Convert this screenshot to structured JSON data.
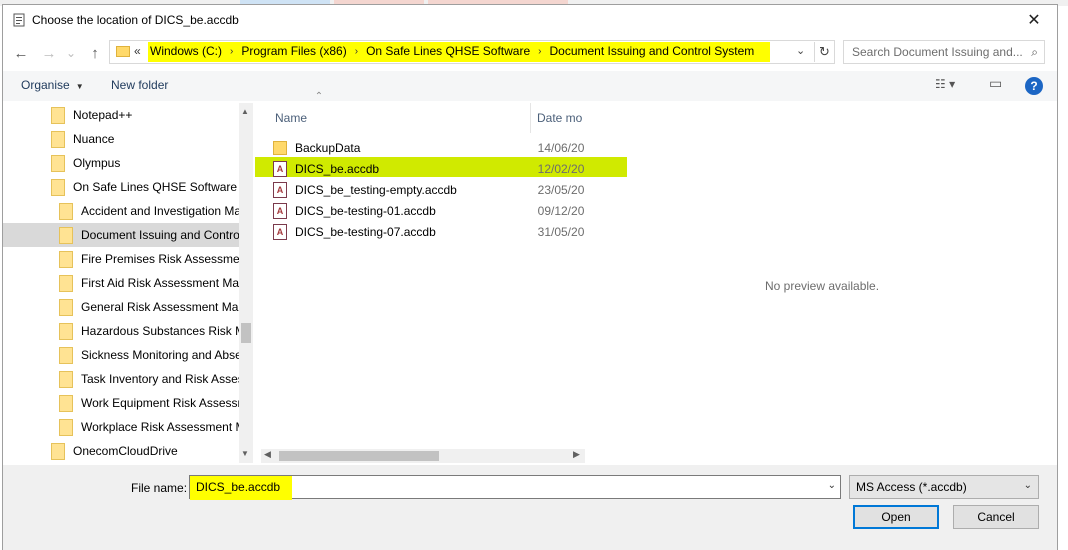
{
  "colors": {
    "highlight": "#ffff00",
    "selection_highlight": "#d0ea00",
    "help_blue": "#1c66c4",
    "focus_blue": "#0078d7"
  },
  "window": {
    "title": "Choose the location of DICS_be.accdb",
    "title_icon": "access-db-icon",
    "close_glyph": "✕"
  },
  "nav": {
    "back_glyph": "←",
    "forward_glyph": "→",
    "history_glyph": "⌄",
    "up_glyph": "↑",
    "overflow_glyph": "«",
    "breadcrumbs": [
      "Windows (C:)",
      "Program Files (x86)",
      "On Safe Lines QHSE Software",
      "Document Issuing and Control System"
    ],
    "crumb_separator": "›",
    "dropdown_glyph": "⌄",
    "refresh_glyph": "↻"
  },
  "search": {
    "placeholder": "Search Document Issuing and...",
    "icon_glyph": "⌕"
  },
  "toolbar": {
    "organise_label": "Organise",
    "organise_caret": "▼",
    "new_folder_label": "New folder",
    "view_glyph": "☷",
    "view_caret": "▾",
    "pane_glyph": "▭",
    "help_glyph": "?"
  },
  "tree": {
    "items": [
      {
        "label": "Notepad++",
        "level": 0
      },
      {
        "label": "Nuance",
        "level": 0
      },
      {
        "label": "Olympus",
        "level": 0
      },
      {
        "label": "On Safe Lines QHSE Software",
        "level": 0
      },
      {
        "label": "Accident and Investigation Ma",
        "level": 1
      },
      {
        "label": "Document Issuing and Contro",
        "level": 1,
        "selected": true
      },
      {
        "label": "Fire Premises Risk Assessment",
        "level": 1
      },
      {
        "label": "First Aid Risk Assessment Mar",
        "level": 1
      },
      {
        "label": "General Risk Assessment Mana",
        "level": 1
      },
      {
        "label": "Hazardous Substances Risk M",
        "level": 1
      },
      {
        "label": "Sickness Monitoring and Abse",
        "level": 1
      },
      {
        "label": "Task Inventory and Risk Asses",
        "level": 1
      },
      {
        "label": "Work Equipment Risk Assessm",
        "level": 1
      },
      {
        "label": "Workplace Risk Assessment M",
        "level": 1
      },
      {
        "label": "OnecomCloudDrive",
        "level": 0
      }
    ],
    "scroll_up": "▲",
    "scroll_down": "▼"
  },
  "files": {
    "columns": {
      "name": "Name",
      "date": "Date mo",
      "sort_glyph": "⌃"
    },
    "rows": [
      {
        "name": "BackupData",
        "date": "14/06/20",
        "icon": "folder-icon"
      },
      {
        "name": "DICS_be.accdb",
        "date": "12/02/20",
        "icon": "access-file-icon",
        "selected": true
      },
      {
        "name": "DICS_be_testing-empty.accdb",
        "date": "23/05/20",
        "icon": "access-file-icon"
      },
      {
        "name": "DICS_be-testing-01.accdb",
        "date": "09/12/20",
        "icon": "access-file-icon"
      },
      {
        "name": "DICS_be-testing-07.accdb",
        "date": "31/05/20",
        "icon": "access-file-icon"
      }
    ],
    "access_glyph": "A",
    "scroll_left": "◀",
    "scroll_right": "▶"
  },
  "preview": {
    "text": "No preview available."
  },
  "footer": {
    "file_name_label": "File name:",
    "file_name_value": "DICS_be.accdb",
    "dropdown_glyph": "⌄",
    "type_value": "MS Access (*.accdb)",
    "open_label": "Open",
    "cancel_label": "Cancel"
  }
}
